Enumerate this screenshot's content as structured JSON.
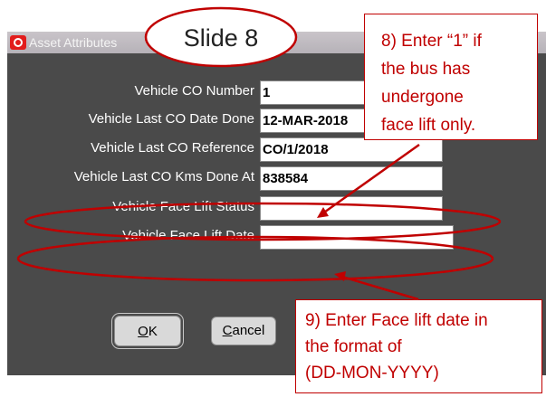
{
  "window": {
    "title": "Asset Attributes"
  },
  "form": {
    "rows": [
      {
        "label": "Vehicle CO Number",
        "value": "1"
      },
      {
        "label": "Vehicle Last CO Date Done",
        "value": "12-MAR-2018"
      },
      {
        "label": "Vehicle Last CO Reference",
        "value": "CO/1/2018"
      },
      {
        "label": "Vehicle Last CO Kms Done At",
        "value": "838584"
      },
      {
        "label": "Vehicle Face Lift Status",
        "value": ""
      },
      {
        "label": "Vehicle Face Lift Date",
        "value": ""
      }
    ]
  },
  "buttons": {
    "ok_mnemonic": "O",
    "ok_rest": "K",
    "cancel_mnemonic": "C",
    "cancel_rest": "ancel"
  },
  "annotations": {
    "slide_label": "Slide 8",
    "callout8_lines": [
      "8) Enter “1” if",
      "the bus has",
      "undergone",
      "face lift only."
    ],
    "callout9_lines": [
      "9) Enter Face lift date in",
      "the format of",
      "(DD-MON-YYYY)"
    ],
    "accent_color": "#c00000"
  }
}
